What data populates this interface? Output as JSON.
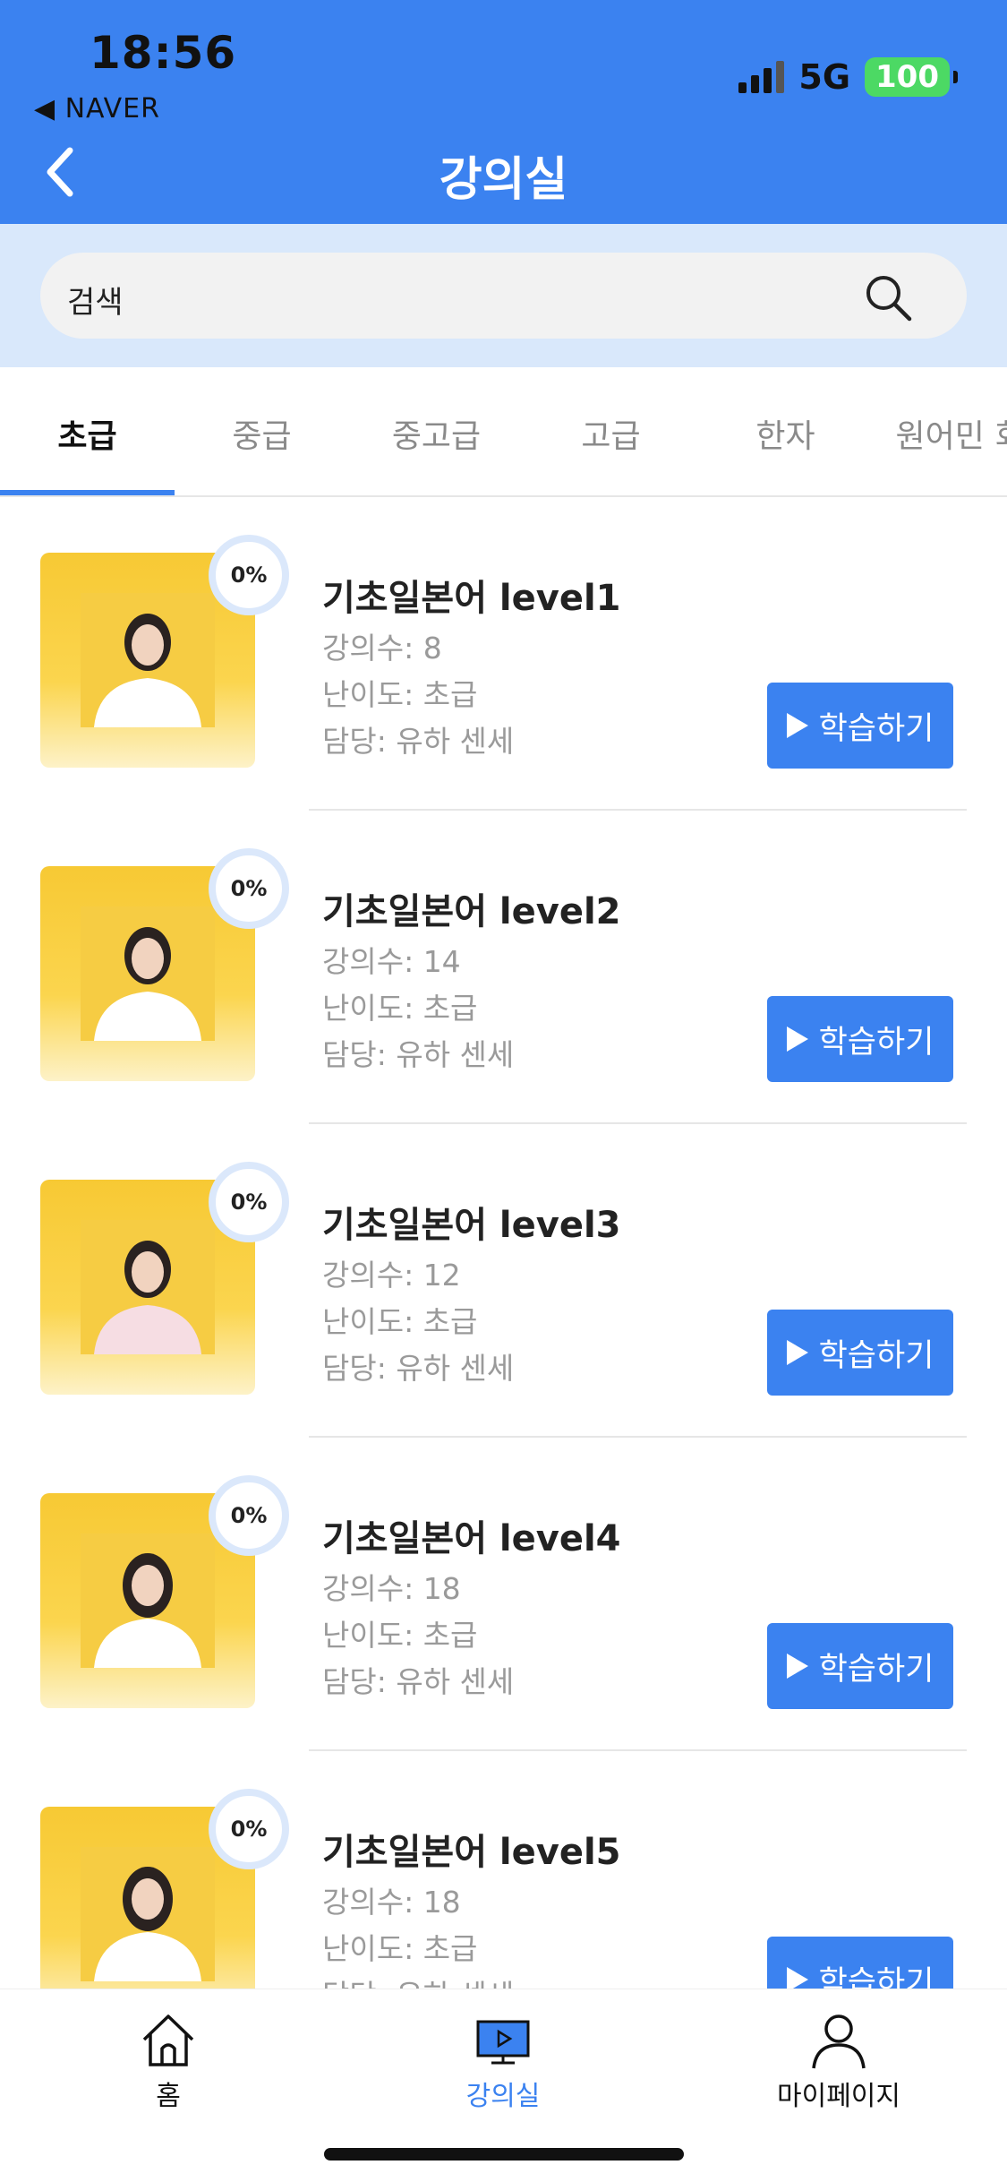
{
  "status_bar": {
    "time": "18:56",
    "back_app": "◀ NAVER",
    "network": "5G",
    "battery": "100"
  },
  "header": {
    "title": "강의실"
  },
  "search": {
    "placeholder": "검색"
  },
  "tabs": [
    {
      "label": "초급",
      "active": true
    },
    {
      "label": "중급"
    },
    {
      "label": "중고급"
    },
    {
      "label": "고급"
    },
    {
      "label": "한자"
    },
    {
      "label": "원어민 회"
    }
  ],
  "courses": [
    {
      "progress": "0%",
      "title": "기초일본어 level1",
      "count": "강의수: 8",
      "difficulty": "난이도: 초급",
      "instructor": "담당: 유하 센세",
      "button": "학습하기"
    },
    {
      "progress": "0%",
      "title": "기초일본어 level2",
      "count": "강의수: 14",
      "difficulty": "난이도: 초급",
      "instructor": "담당: 유하 센세",
      "button": "학습하기"
    },
    {
      "progress": "0%",
      "title": "기초일본어 level3",
      "count": "강의수: 12",
      "difficulty": "난이도: 초급",
      "instructor": "담당: 유하 센세",
      "button": "학습하기"
    },
    {
      "progress": "0%",
      "title": "기초일본어 level4",
      "count": "강의수: 18",
      "difficulty": "난이도: 초급",
      "instructor": "담당: 유하 센세",
      "button": "학습하기"
    },
    {
      "progress": "0%",
      "title": "기초일본어 level5",
      "count": "강의수: 18",
      "difficulty": "난이도: 초급",
      "instructor": "담당: 유하 센세",
      "button": "학습하기"
    }
  ],
  "bottom_nav": [
    {
      "label": "홈",
      "icon": "home-icon"
    },
    {
      "label": "강의실",
      "icon": "classroom-icon",
      "active": true
    },
    {
      "label": "마이페이지",
      "icon": "profile-icon"
    }
  ],
  "colors": {
    "primary": "#3b82f0",
    "search_band": "#d9e8fb",
    "thumb_yellow": "#f7c934"
  }
}
